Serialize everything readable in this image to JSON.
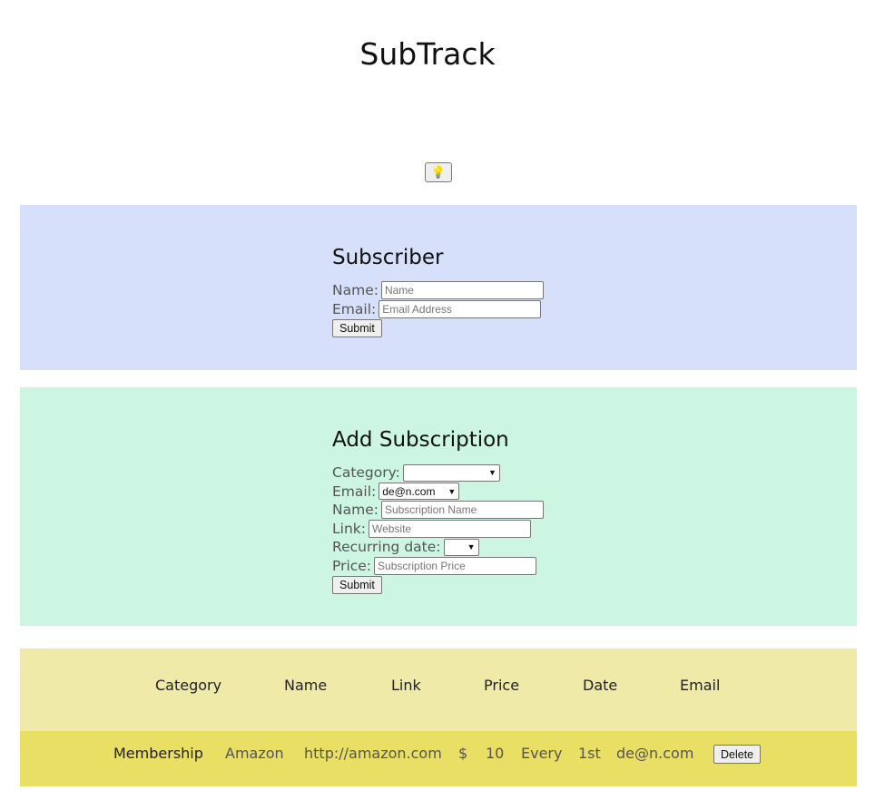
{
  "app": {
    "title": "SubTrack",
    "theme_toggle_icon": "lightbulb-icon"
  },
  "theme_toggle": {
    "glyph": "💡"
  },
  "subscriber": {
    "heading": "Subscriber",
    "name_label": "Name:",
    "name_placeholder": "Name",
    "email_label": "Email:",
    "email_placeholder": "Email Address",
    "submit_label": "Submit"
  },
  "add_subscription": {
    "heading": "Add Subscription",
    "category_label": "Category:",
    "category_value": "",
    "email_label": "Email:",
    "email_value": "de@n.com",
    "name_label": "Name:",
    "name_placeholder": "Subscription Name",
    "link_label": "Link:",
    "link_placeholder": "Website",
    "recurring_label": "Recurring date:",
    "recurring_value": "",
    "price_label": "Price:",
    "price_placeholder": "Subscription Price",
    "submit_label": "Submit"
  },
  "table": {
    "headers": [
      "Category",
      "Name",
      "Link",
      "Price",
      "Date",
      "Email"
    ],
    "rows": [
      {
        "category": "Membership",
        "name": "Amazon",
        "link": "http://amazon.com",
        "currency": "$",
        "price": "10",
        "every": "Every",
        "date": "1st",
        "email": "de@n.com",
        "delete_label": "Delete"
      }
    ]
  },
  "colors": {
    "subscriber_bg": "#d6e0fb",
    "add_bg": "#ccf6e2",
    "table_header_bg": "#f0eaa9",
    "table_row_bg": "#e8df64"
  }
}
